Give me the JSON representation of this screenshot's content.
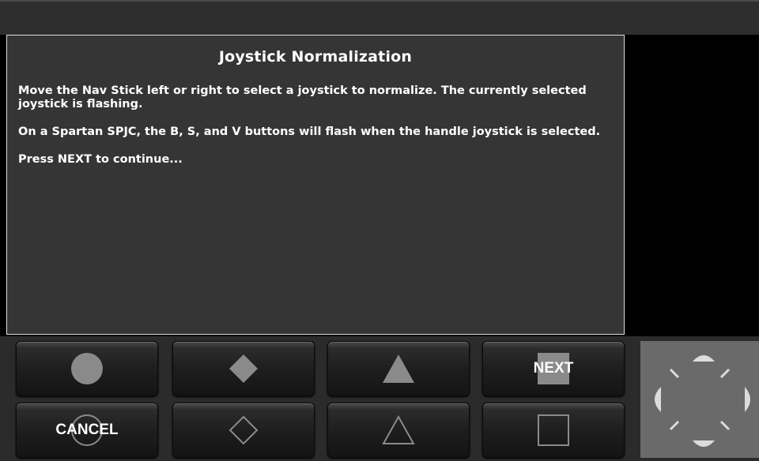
{
  "dialog": {
    "title": "Joystick Normalization",
    "paragraphs": [
      "Move the Nav Stick left or right to select a joystick to normalize. The currently selected joystick is flashing.",
      "On a Spartan SPJC, the B, S, and V buttons will flash when the handle joystick is selected.",
      "Press NEXT to continue..."
    ]
  },
  "buttons": {
    "top_row": [
      {
        "icon": "circle-filled-icon",
        "label": ""
      },
      {
        "icon": "diamond-filled-icon",
        "label": ""
      },
      {
        "icon": "triangle-filled-icon",
        "label": ""
      },
      {
        "icon": "square-filled-icon",
        "label": "NEXT"
      }
    ],
    "bottom_row": [
      {
        "icon": "circle-outline-icon",
        "label": "CANCEL"
      },
      {
        "icon": "diamond-outline-icon",
        "label": ""
      },
      {
        "icon": "triangle-outline-icon",
        "label": ""
      },
      {
        "icon": "square-outline-icon",
        "label": ""
      }
    ]
  },
  "dpad": {
    "icon": "directional-pad-icon"
  }
}
